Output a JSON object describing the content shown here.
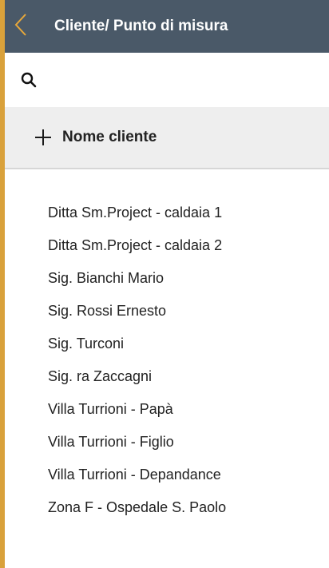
{
  "header": {
    "title": "Cliente/ Punto di misura",
    "back_icon": "chevron-left-icon",
    "accent_color": "#d9a13b",
    "background_color": "#4a5968"
  },
  "search": {
    "icon": "search-icon",
    "value": "",
    "placeholder": ""
  },
  "add_client": {
    "icon": "plus-icon",
    "label": "Nome cliente"
  },
  "clients": [
    "Ditta Sm.Project - caldaia 1",
    "Ditta Sm.Project - caldaia 2",
    "Sig. Bianchi Mario",
    "Sig. Rossi Ernesto",
    "Sig. Turconi",
    "Sig. ra Zaccagni",
    "Villa Turrioni - Papà",
    "Villa Turrioni - Figlio",
    "Villa Turrioni - Depandance",
    "Zona F - Ospedale S. Paolo"
  ]
}
